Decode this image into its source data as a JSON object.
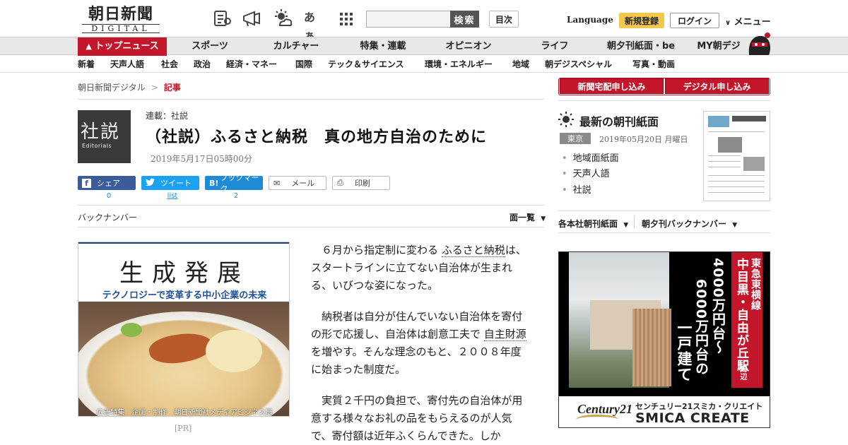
{
  "header": {
    "logo_main": "朝日新聞",
    "logo_sub": "DIGITAL",
    "icons": [
      "paper-icon",
      "megaphone-icon",
      "weather-icon",
      "font-size-icon",
      "grid-menu-icon"
    ],
    "font_icon_label": "あぁ",
    "search_placeholder": "",
    "search_button": "検索",
    "mokuji_button": "目次",
    "language": "Language",
    "signup": "新規登録",
    "login": "ログイン",
    "menu": "メニュー"
  },
  "nav_primary": [
    "トップニュース",
    "スポーツ",
    "カルチャー",
    "特集・連載",
    "オピニオン",
    "ライフ",
    "朝夕刊紙面・be",
    "MY朝デジ"
  ],
  "nav_secondary": [
    "新着",
    "天声人語",
    "社会",
    "政治",
    "経済・マネー",
    "国際",
    "テック＆サイエンス",
    "環境・エネルギー",
    "地域",
    "朝デジスペシャル",
    "写真・動画"
  ],
  "breadcrumb": {
    "root": "朝日新聞デジタル",
    "separator": ">",
    "current": "記事"
  },
  "article": {
    "thumb_big": "社説",
    "thumb_small": "Editorials",
    "series": "連載：社説",
    "headline": "（社説）ふるさと納税　真の地方自治のために",
    "date": "2019年5月17日05時00分",
    "paragraphs": [
      [
        "６月から指定制に変わる",
        "ふるさと納税",
        "は、スタートラインに立てない自治体が生まれる、いびつな姿になった。"
      ],
      [
        "納税者は自分が住んでいない自治体を寄付の形で応援し、自治体は創意工夫で",
        "自主財源",
        "を増やす。そんな理念のもと、２００８年度に始まった制度だ。"
      ],
      [
        "実質２千円の負担で、寄付先の自治体が用意する様々なお礼の品をもらえるのが人気で、寄付額は近年ふくらんできた。しか",
        "",
        ""
      ]
    ]
  },
  "share": {
    "facebook": "シェア",
    "facebook_count": "0",
    "twitter": "ツイート",
    "twitter_count": "list",
    "hatena": "ブックマーク",
    "hatena_icon": "B!",
    "hatena_count": "2",
    "mail": "メール",
    "print": "印刷"
  },
  "backnumber": "バックナンバー",
  "menlist": "面一覧",
  "pr_ad": {
    "title": "生成発展",
    "subtitle": "テクノロジーで変革する中小企業の未来",
    "caption": "広告特集　企画・制作　朝日新聞社メディアビジネス局",
    "tag": "[PR]"
  },
  "right": {
    "subscribe_paper": "新聞宅配申し込み",
    "subscribe_digital": "デジタル申し込み",
    "latest_title": "最新の朝刊紙面",
    "region": "東京",
    "latest_date": "2019年05月20日 月曜日",
    "links": [
      "地域面紙面",
      "天声人語",
      "社説"
    ],
    "select_paper": "各本社朝刊紙面",
    "select_back": "朝夕刊バックナンバー"
  },
  "realestate_ad": {
    "line": "東急東横線",
    "station": "中目黒・自由が丘駅",
    "station_suffix": "周辺",
    "price1": "4000万円台～",
    "price2": "6000万円台の",
    "type": "一戸建て",
    "logo": "Century21",
    "company_jp": "センチュリー21スミカ・クリエイト",
    "company_en": "SMICA CREATE"
  },
  "colors": {
    "brand_red": "#c4162a",
    "signup_yellow": "#f5c84c",
    "facebook": "#3b5b9b",
    "twitter": "#1da1f2",
    "hatena": "#1e8bd6"
  }
}
